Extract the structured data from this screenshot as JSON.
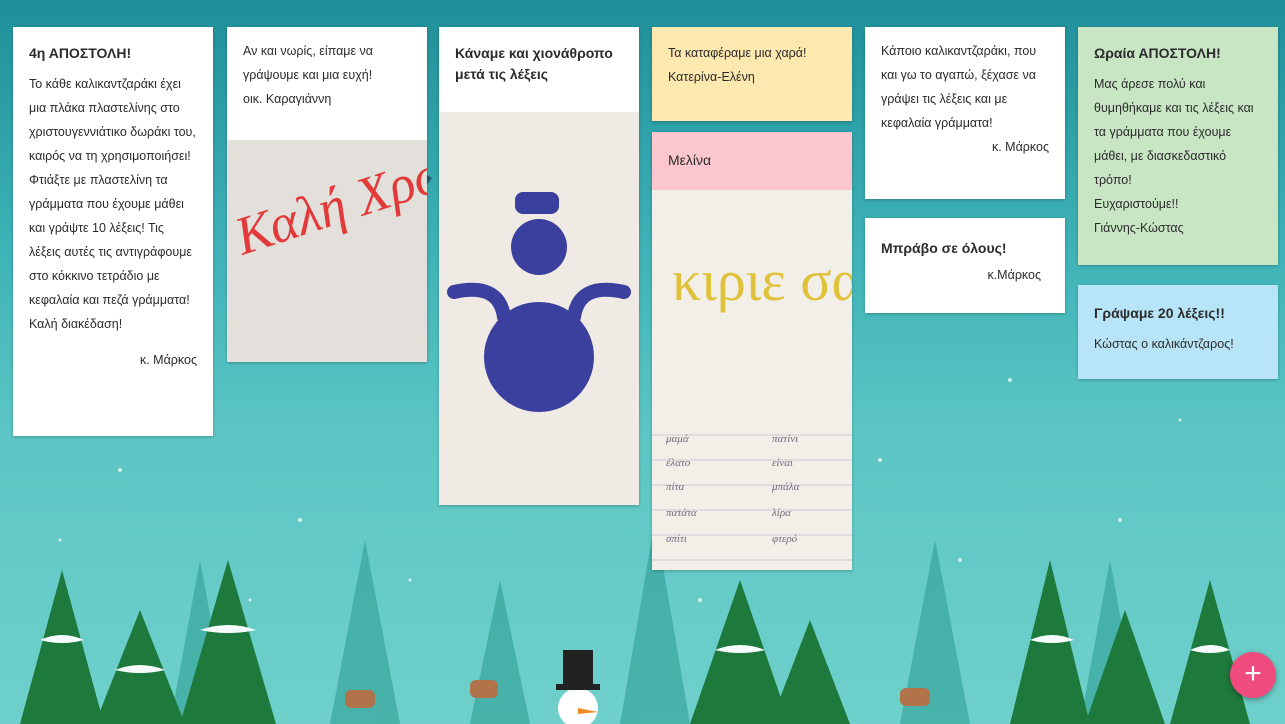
{
  "cards": [
    {
      "title": "4η ΑΠΟΣΤΟΛΗ!",
      "body": "Το κάθε καλικαντζαράκι έχει μια πλάκα πλαστελίνης στο χριστουγεννιάτικο δωράκι του, καιρός να τη χρησιμοποιήσει! Φτιάξτε με πλαστελίνη τα γράμματα που έχουμε μάθει και γράψτε 10 λέξεις! Τις λέξεις αυτές τις αντιγράφουμε στο κόκκινο τετράδιο με κεφαλαία και πεζά γράμματα!\nΚαλή διακέδαση!",
      "signature": "κ. Μάρκος",
      "color": "#ffffff"
    },
    {
      "title": "",
      "body": "Αν και νωρίς, είπαμε να γράψουμε και μια ευχή!\nοικ. Καραγιάννη",
      "color": "#ffffff",
      "photo_text": "Καλή Χρονιά"
    },
    {
      "title": "Κάναμε και χιονάθροπο μετά τις λέξεις",
      "body": "",
      "color": "#ffffff"
    },
    {
      "title": "",
      "body": "Τα καταφέραμε μια χαρά!\nΚατερίνα-Ελένη",
      "color": "#fde8b0"
    },
    {
      "title": "Μελίνα",
      "body": "",
      "color": "#fbc6cd",
      "photo_text": "κιριε σαγαπω",
      "notebook": [
        "μαμά",
        "πατίνι",
        "έλατο",
        "είναι",
        "πίτα",
        "μπάλα",
        "πατάτα",
        "λίρα",
        "σπίτι",
        "φτερό"
      ]
    },
    {
      "title": "",
      "body": "Κάποιο καλικαντζαράκι, που και γω το αγαπώ, ξέχασε να γράψει τις λέξεις και με κεφαλαία γράμματα!",
      "signature": "κ. Μάρκος",
      "color": "#ffffff"
    },
    {
      "title": "Μπράβο σε όλους!",
      "body": "",
      "signature": "κ.Μάρκος",
      "color": "#ffffff"
    },
    {
      "title": "Ωραία ΑΠΟΣΤΟΛΗ!",
      "body": "Μας άρεσε πολύ και θυμηθήκαμε και τις λέξεις και τα γράμματα που έχουμε μάθει, με διασκεδαστικό τρόπο!\nΕυχαριστούμε!!\nΓιάννης-Κώστας",
      "color": "#c8e6c4"
    },
    {
      "title": "Γράψαμε 20 λέξεις!!",
      "body": "Κώστας ο καλικάντζαρος!",
      "color": "#b8e4f7"
    }
  ],
  "fab": {
    "label": "+"
  }
}
